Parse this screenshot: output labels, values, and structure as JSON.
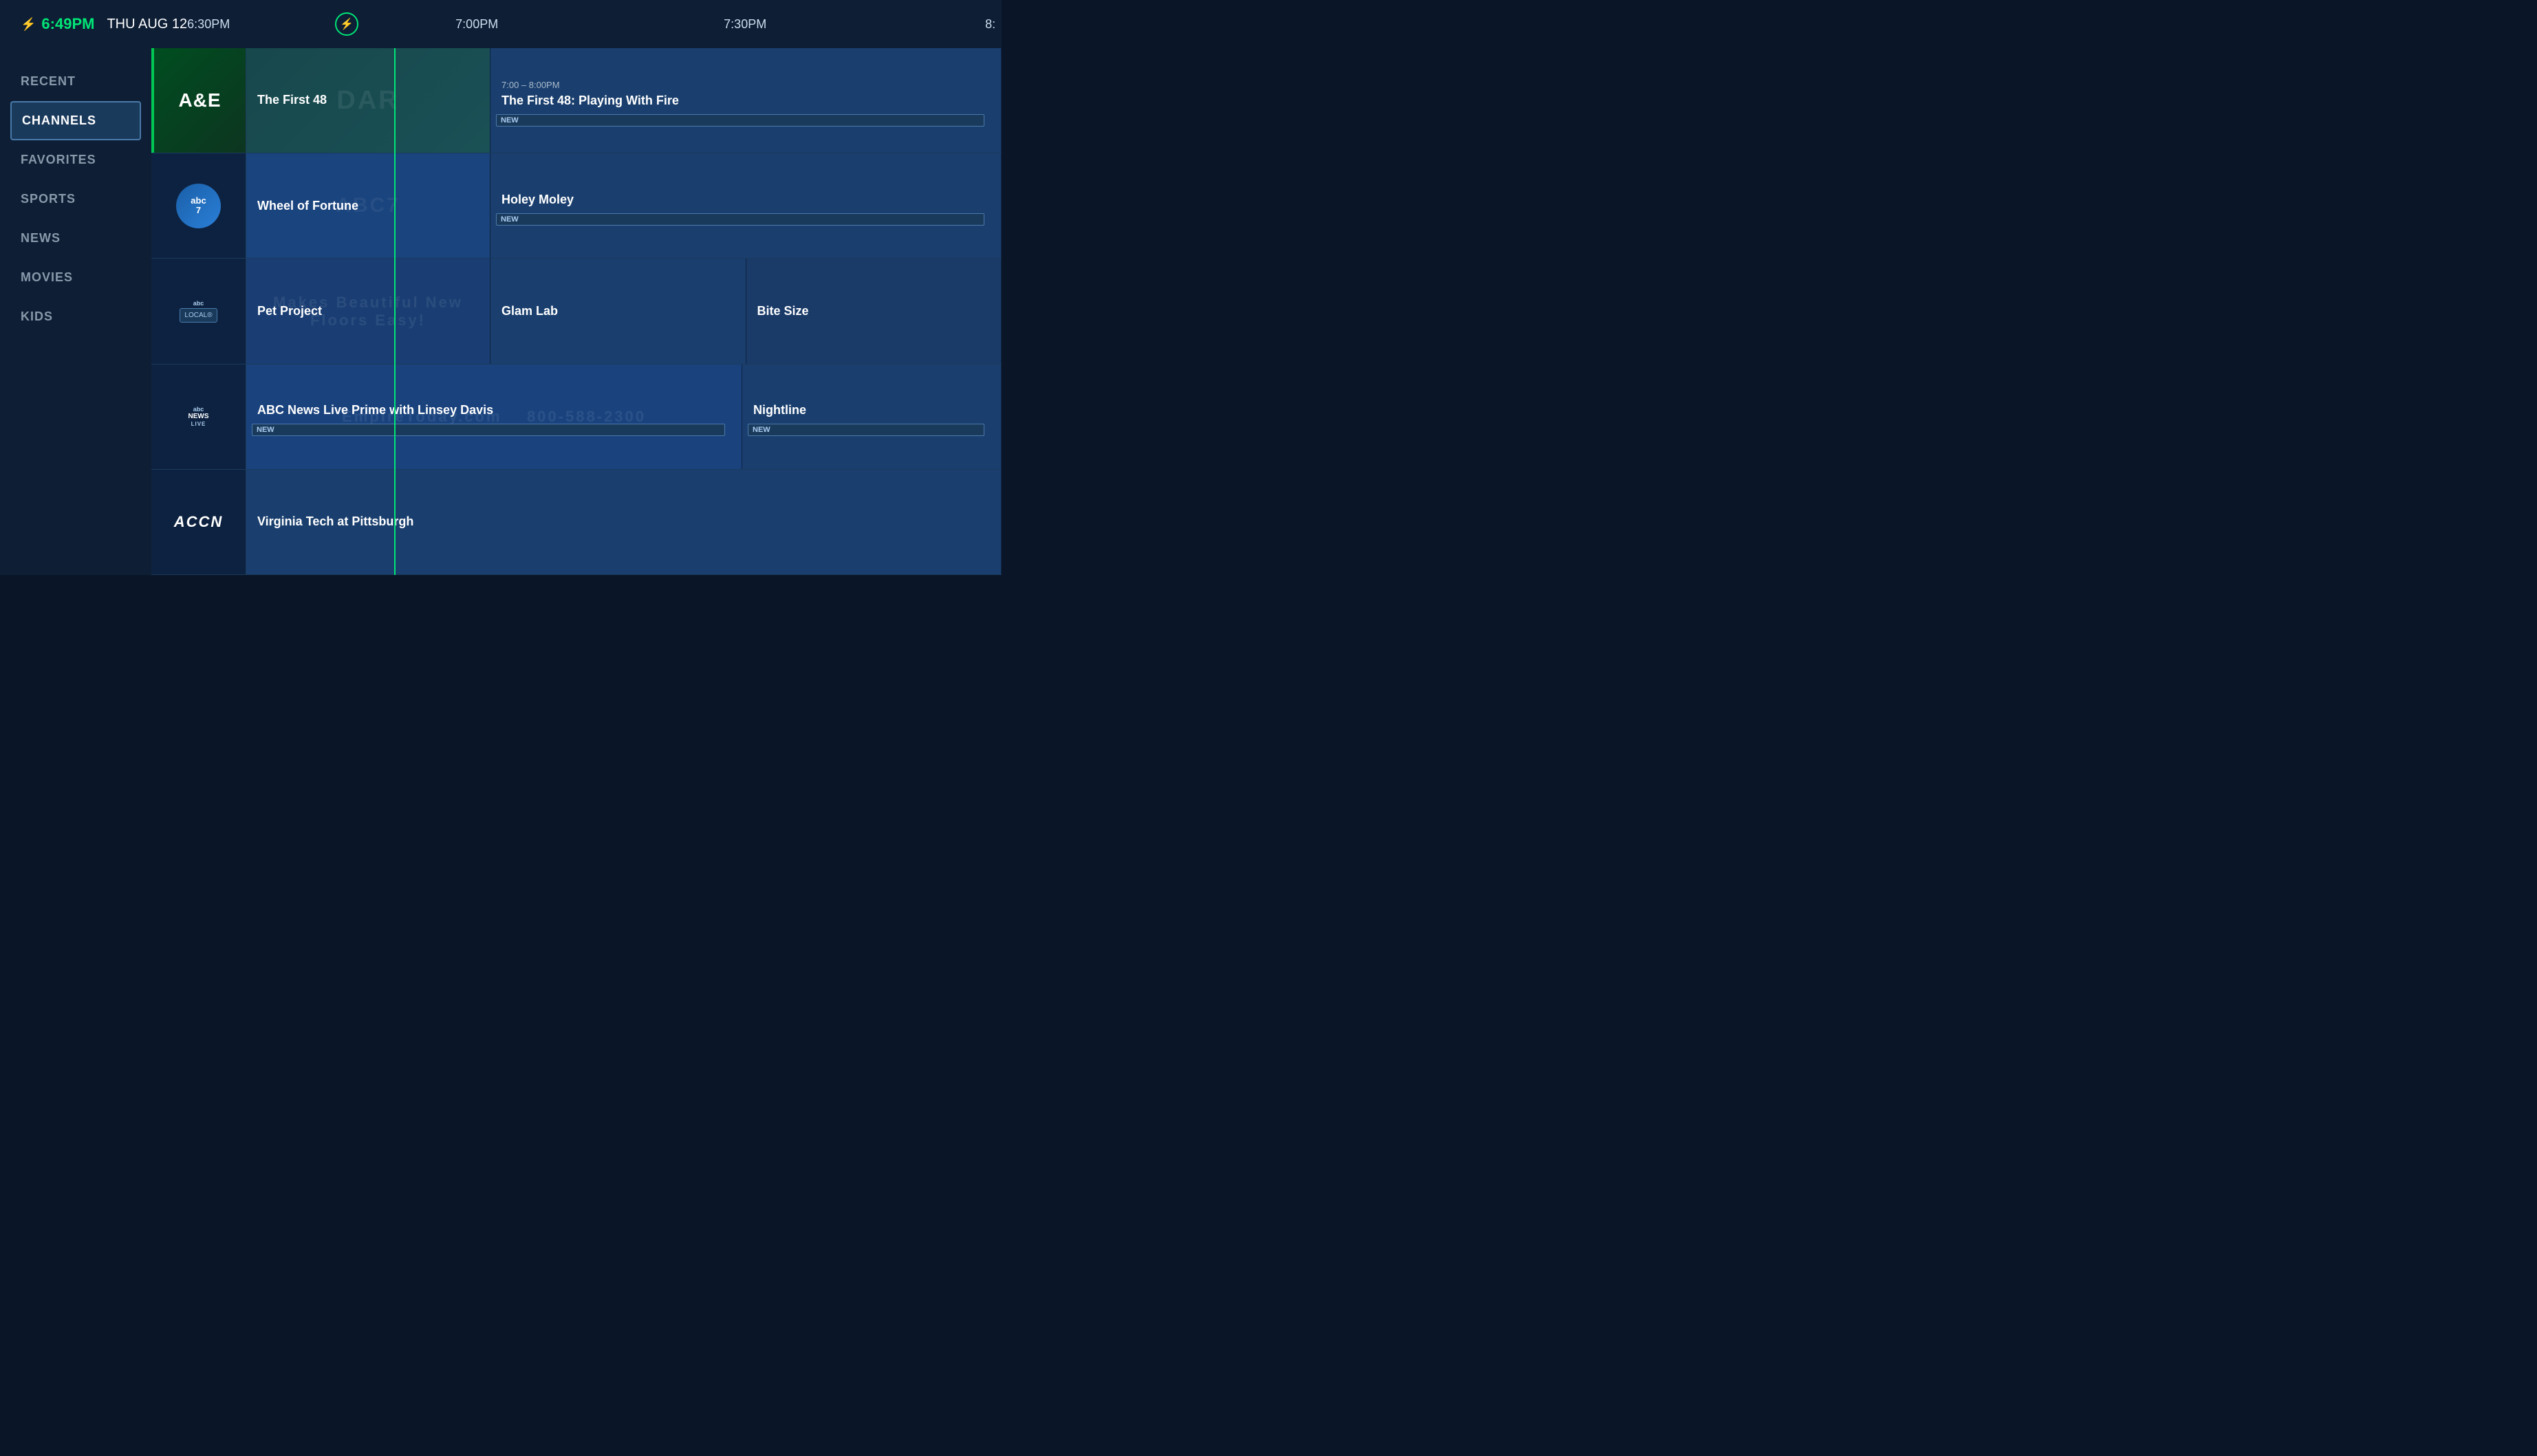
{
  "header": {
    "time": "6:49PM",
    "date": "THU AUG 12",
    "time_slots": [
      "6:30PM",
      "7:00PM",
      "7:30PM",
      "8:"
    ],
    "time_slot_label": "now"
  },
  "sidebar": {
    "items": [
      {
        "label": "RECENT",
        "active": false
      },
      {
        "label": "CHANNELS",
        "active": true
      },
      {
        "label": "FAVORITES",
        "active": false
      },
      {
        "label": "SPORTS",
        "active": false
      },
      {
        "label": "NEWS",
        "active": false
      },
      {
        "label": "MOVIES",
        "active": false
      },
      {
        "label": "KIDS",
        "active": false
      }
    ]
  },
  "guide": {
    "rows": [
      {
        "channel": "A&E",
        "channel_type": "ae",
        "programs": [
          {
            "title": "The First 48",
            "time": null,
            "new": false,
            "width": "wide"
          },
          {
            "title": "The First 48: Playing With Fire",
            "time": "7:00 – 8:00PM",
            "new": true,
            "width": "wide"
          }
        ]
      },
      {
        "channel": "abc7",
        "channel_type": "abc7",
        "programs": [
          {
            "title": "Wheel of Fortune",
            "time": null,
            "new": false,
            "width": "wide"
          },
          {
            "title": "Holey Moley",
            "time": null,
            "new": true,
            "width": "wide"
          }
        ]
      },
      {
        "channel": "ABC Local",
        "channel_type": "local",
        "programs": [
          {
            "title": "Pet Project",
            "time": null,
            "new": false,
            "width": "wide"
          },
          {
            "title": "Glam Lab",
            "time": null,
            "new": false,
            "width": "normal"
          },
          {
            "title": "Bite Size",
            "time": null,
            "new": false,
            "width": "normal"
          }
        ]
      },
      {
        "channel": "ABC News Live",
        "channel_type": "abcnewslive",
        "programs": [
          {
            "title": "ABC News Live Prime with Linsey Davis",
            "time": null,
            "new": true,
            "width": "widest"
          },
          {
            "title": "Nightline",
            "time": null,
            "new": true,
            "width": "normal"
          }
        ]
      },
      {
        "channel": "ACCN",
        "channel_type": "accn",
        "programs": [
          {
            "title": "Virginia Tech at Pittsburgh",
            "time": null,
            "new": false,
            "width": "full"
          }
        ]
      }
    ]
  }
}
